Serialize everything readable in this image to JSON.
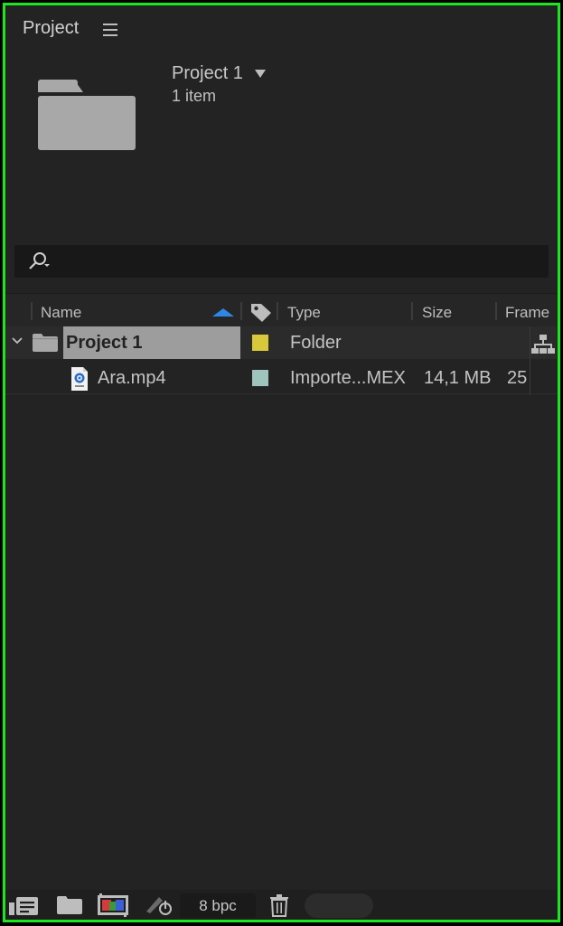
{
  "panel": {
    "title": "Project"
  },
  "project_info": {
    "name": "Project 1",
    "count": "1 item"
  },
  "columns": {
    "name": "Name",
    "type": "Type",
    "size": "Size",
    "frame": "Frame"
  },
  "rows": [
    {
      "name": "Project 1",
      "label_color": "#d9c93a",
      "type": "Folder",
      "size": "",
      "frame": ""
    },
    {
      "name": "Ara.mp4",
      "label_color": "#9fc3bd",
      "type": "Importe...MEX",
      "size": "14,1 MB",
      "frame": "25"
    }
  ],
  "footer": {
    "bpc": "8 bpc"
  },
  "colors": {
    "accent": "#2f86e6",
    "border": "#1ee61e",
    "bg": "#232323"
  }
}
